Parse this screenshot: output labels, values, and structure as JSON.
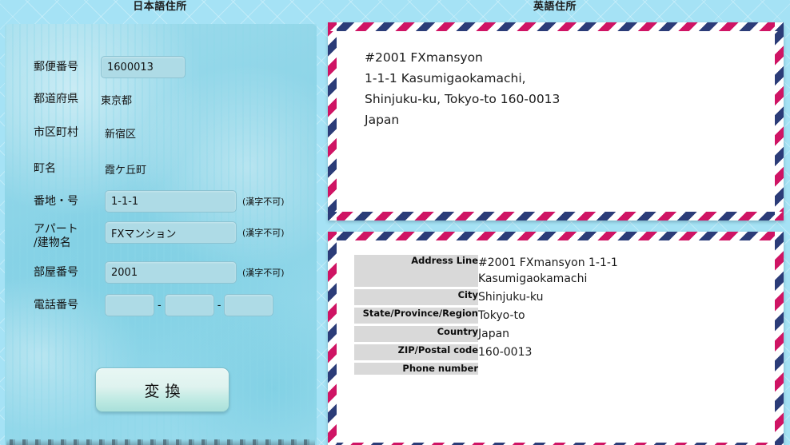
{
  "headers": {
    "japanese_address": "日本語住所",
    "english_address": "英語住所"
  },
  "colors": {
    "page_background": "#a5e2f5",
    "paper_panel": "#8ed6e8",
    "input_fill": "#aedbe6",
    "airmail_red": "#cf1464",
    "airmail_blue": "#2b3c78",
    "table_key_background": "#d9d9d9"
  },
  "form": {
    "fields": [
      {
        "label": "郵便番号",
        "type": "input",
        "value": "1600013",
        "note": ""
      },
      {
        "label": "都道府県",
        "type": "text",
        "value": "東京都",
        "note": ""
      },
      {
        "label": "市区町村",
        "type": "text",
        "value": "新宿区",
        "note": ""
      },
      {
        "label": "町名",
        "type": "text",
        "value": "霞ケ丘町",
        "note": ""
      },
      {
        "label": "番地・号",
        "type": "input",
        "value": "1-1-1",
        "note": "(漢字不可)"
      },
      {
        "label": "アパート\n/建物名",
        "type": "input",
        "value": "FXマンション",
        "note": "(漢字不可)"
      },
      {
        "label": "部屋番号",
        "type": "input",
        "value": "2001",
        "note": "(漢字不可)"
      },
      {
        "label": "電話番号",
        "type": "phone",
        "value": "",
        "note": ""
      }
    ],
    "phone": {
      "part1": "",
      "part2": "",
      "part3": "",
      "separator": "-"
    },
    "submit_label": "変換"
  },
  "envelope_top": {
    "address_block": "#2001 FXmansyon\n1-1-1 Kasumigaokamachi,\nShinjuku-ku, Tokyo-to 160-0013\nJapan"
  },
  "envelope_bottom": {
    "rows": [
      {
        "key": "Address Line",
        "value": "#2001 FXmansyon 1-1-1\nKasumigaokamachi"
      },
      {
        "key": "City",
        "value": "Shinjuku-ku"
      },
      {
        "key": "State/Province/Region",
        "value": "Tokyo-to"
      },
      {
        "key": "Country",
        "value": "Japan"
      },
      {
        "key": "ZIP/Postal code",
        "value": "160-0013"
      },
      {
        "key": "Phone number",
        "value": ""
      }
    ]
  }
}
